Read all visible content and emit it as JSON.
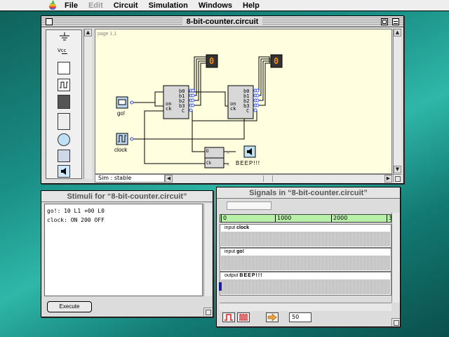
{
  "menubar": {
    "items": [
      "File",
      "Edit",
      "Circuit",
      "Simulation",
      "Windows",
      "Help"
    ],
    "disabled": [
      "Edit"
    ]
  },
  "circuit_window": {
    "title": "8-bit-counter.circuit",
    "page_label": "page 1,1",
    "status": "Sim : stable",
    "palette_vcc": "Vcc",
    "counter1": {
      "ports": [
        "on",
        "ck"
      ],
      "outputs": [
        "b0",
        "b1",
        "b2",
        "b3",
        "C"
      ],
      "display": "0"
    },
    "counter2": {
      "ports": [
        "on",
        "ck"
      ],
      "outputs": [
        "b0",
        "b1",
        "b2",
        "b3",
        "C"
      ],
      "display": "0"
    },
    "components": {
      "go_label": "go!",
      "clock_label": "clock",
      "beep_label": "BEEP!!!"
    },
    "latch": {
      "in_top": "D",
      "in_bottom": "Ck"
    }
  },
  "stimuli_window": {
    "title": "Stimuli for “8-bit-counter.circuit”",
    "lines": [
      "go!: 10 L1 +00 L0",
      "clock: ON 200 OFF"
    ],
    "execute_label": "Execute"
  },
  "signals_window": {
    "title": "Signals in “8-bit-counter.circuit”",
    "ruler_ticks": [
      "0",
      "1000",
      "2000",
      "3"
    ],
    "tracks": [
      {
        "kind": "input",
        "name": "clock"
      },
      {
        "kind": "input",
        "name": "go!"
      },
      {
        "kind": "output",
        "name": "BEEP!!!"
      }
    ],
    "zoom_value": "50"
  },
  "colors": {
    "desktop": "#1a8f86",
    "canvas": "#ffffe0",
    "ruler": "#b7f1a8",
    "display_bg": "#333333",
    "display_digit": "#ff8800",
    "pin": "#3355ee",
    "arrow_tool": "#f0a040",
    "wave_tool": "#d22222"
  }
}
